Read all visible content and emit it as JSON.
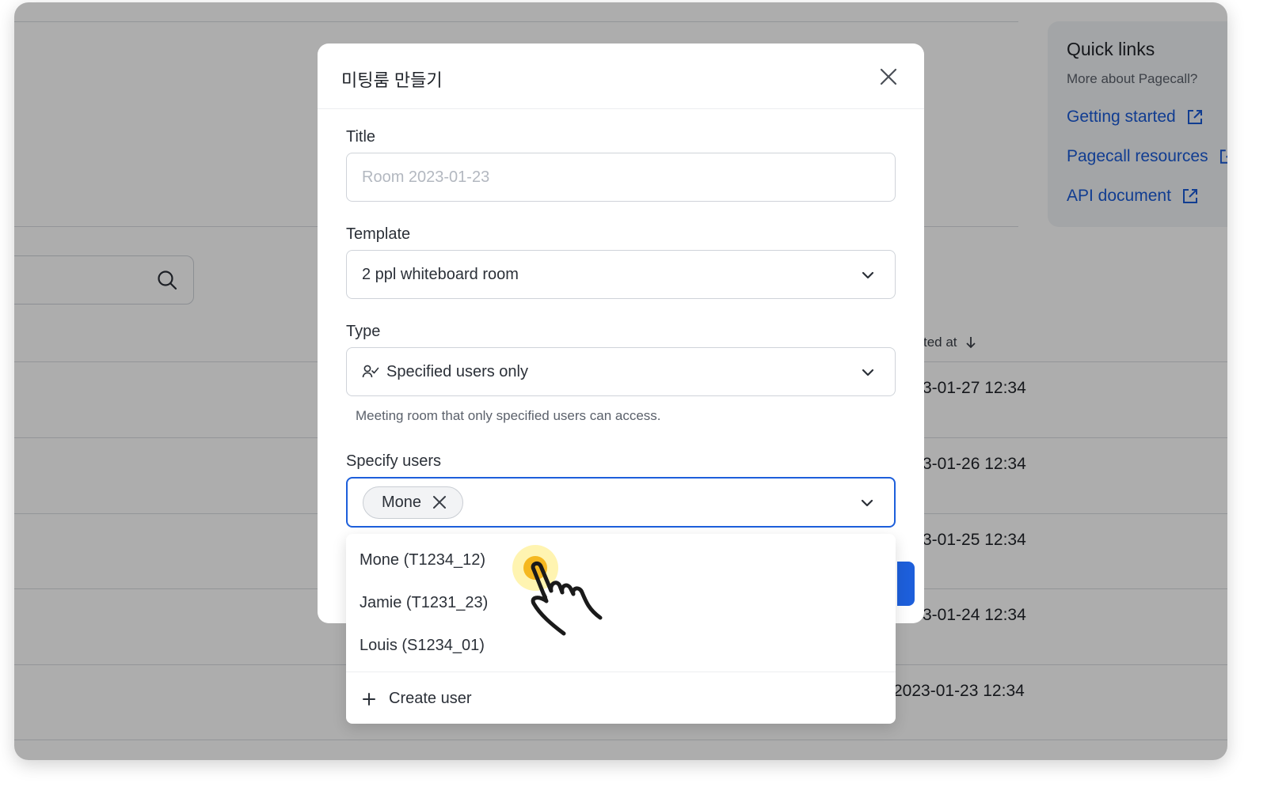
{
  "modal": {
    "title": "미팅룸 만들기",
    "fields": {
      "title_label": "Title",
      "title_placeholder": "Room 2023-01-23",
      "template_label": "Template",
      "template_value": "2 ppl whiteboard room",
      "type_label": "Type",
      "type_value": "Specified users only",
      "type_helper": "Meeting room that only specified users can access.",
      "users_label": "Specify users",
      "selected_user": "Mone"
    }
  },
  "dropdown": {
    "options": [
      "Mone (T1234_12)",
      "Jamie (T1231_23)",
      "Louis (S1234_01)"
    ],
    "create_label": "Create user"
  },
  "quick_links": {
    "title": "Quick links",
    "subtitle": "More about Pagecall?",
    "links": [
      "Getting started",
      "Pagecall resources",
      "API document"
    ]
  },
  "background_table": {
    "sort_column": "ted at",
    "dates": [
      "3-01-27 12:34",
      "3-01-26 12:34",
      "3-01-25 12:34",
      "3-01-24 12:34",
      "2023-01-23 12:34"
    ]
  },
  "colors": {
    "accent": "#1d5fdb",
    "link": "#1a5ad6",
    "cursor_highlight": "#f5c518"
  }
}
